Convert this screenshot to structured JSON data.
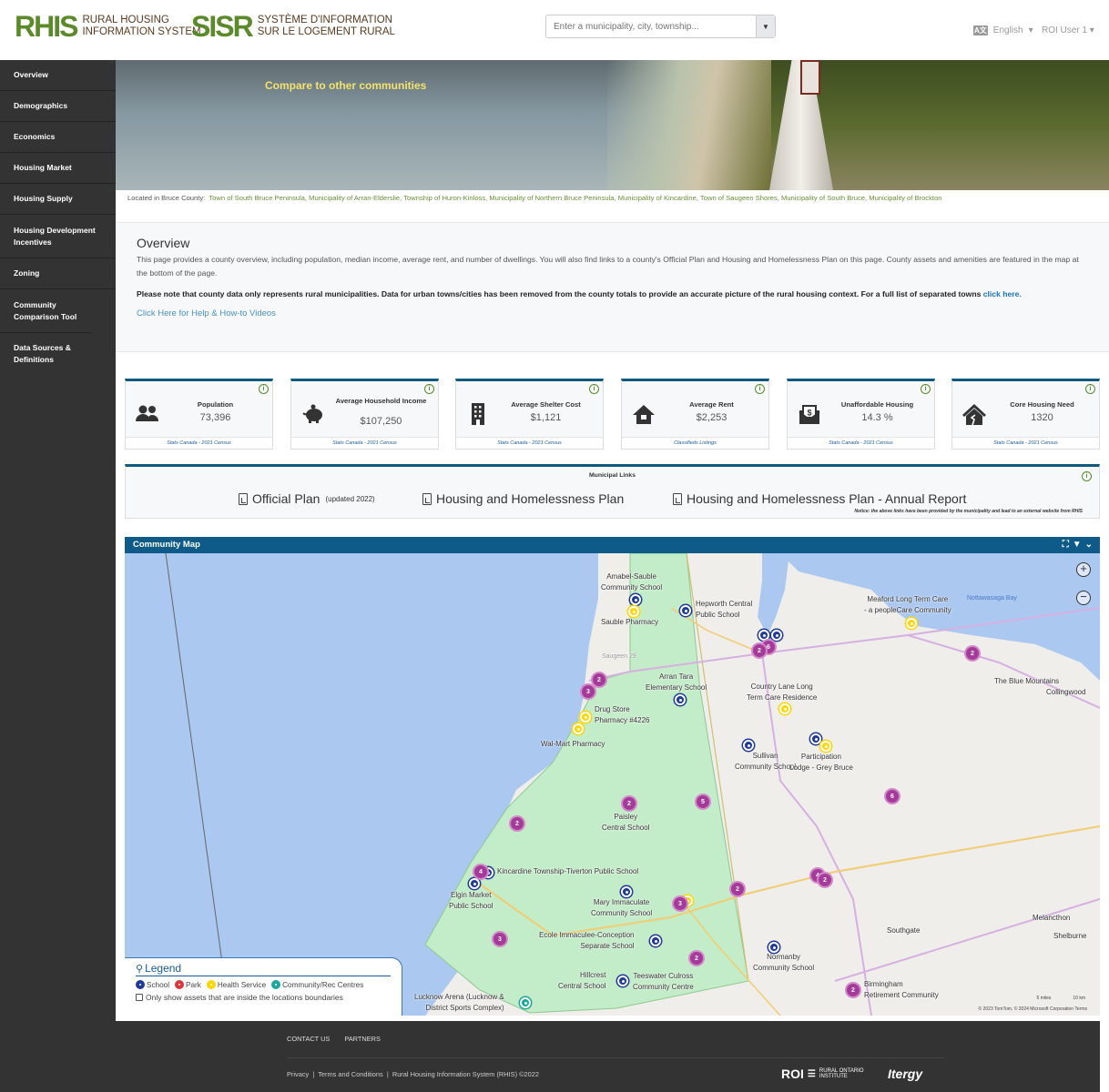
{
  "header": {
    "logo_en": {
      "acronym": "RHIS",
      "line1": "RURAL HOUSING",
      "line2": "INFORMATION SYSTEM"
    },
    "logo_fr": {
      "acronym": "SISR",
      "line1": "SYSTÈME D'INFORMATION",
      "line2": "SUR LE LOGEMENT RURAL"
    },
    "search": {
      "placeholder": "Enter a municipality, city, township...",
      "value": "",
      "dropdown_icon": "caret-down"
    },
    "language": {
      "icon": "translate-icon",
      "label": "English",
      "caret": "▾"
    },
    "user": {
      "label": "ROI User 1",
      "caret": "▾"
    }
  },
  "sidebar": {
    "items": [
      {
        "label": "Overview",
        "active": true
      },
      {
        "label": "Demographics"
      },
      {
        "label": "Economics"
      },
      {
        "label": "Housing Market"
      },
      {
        "label": "Housing Supply"
      },
      {
        "label": "Housing Development Incentives"
      },
      {
        "label": "Zoning"
      },
      {
        "label": "Community Comparison Tool"
      },
      {
        "label": "Data Sources & Definitions"
      }
    ]
  },
  "hero": {
    "compare_link": "Compare to other communities",
    "located_prefix": "Located in Bruce County:",
    "municipalities": "Town of South Bruce Peninsula, Municipality of Arran-Elderslie, Township of Huron-Kinloss, Municipality of Northern Bruce Peninsula, Municipality of Kincardine, Town of Saugeen Shores, Municipality of South Bruce, Municipality of Brockton"
  },
  "overview": {
    "title": "Overview",
    "description": "This page provides a county overview, including population, median income, average rent, and number of dwellings. You will also find links to a county's Official Plan and Housing and Homelessness Plan on this page. County assets and amenities are featured in the map at the bottom of the page.",
    "note": "Please note that county data only represents rural municipalities. Data for urban towns/cities has been removed from the county totals to provide an accurate picture of the rural housing context. For a full list of separated towns",
    "note_link": "click here.",
    "help_link": "Click Here for Help & How-to Videos"
  },
  "stats": [
    {
      "label": "Population",
      "value": "73,396",
      "source": "Stats Canada - 2021 Census",
      "icon": "users-icon"
    },
    {
      "label": "Average Household Income",
      "value": "$107,250",
      "source": "Stats Canada - 2021 Census",
      "icon": "piggy-bank-icon"
    },
    {
      "label": "Average Shelter Cost",
      "value": "$1,121",
      "source": "Stats Canada - 2021 Census",
      "icon": "building-icon"
    },
    {
      "label": "Average Rent",
      "value": "$2,253",
      "source": "Classifieds Listings",
      "icon": "house-icon"
    },
    {
      "label": "Unaffordable Housing",
      "value": "14.3 %",
      "source": "Stats Canada - 2021 Census",
      "icon": "money-envelope-icon"
    },
    {
      "label": "Core Housing Need",
      "value": "1320",
      "source": "Stats Canada - 2021 Census",
      "icon": "house-damage-icon"
    }
  ],
  "municipal_links": {
    "title": "Municipal Links",
    "links": [
      {
        "label": "Official Plan",
        "note": "(updated 2022)"
      },
      {
        "label": "Housing and Homelessness Plan",
        "note": ""
      },
      {
        "label": "Housing and Homelessness Plan - Annual Report",
        "note": ""
      }
    ],
    "notice": "Notice: the above links have been provided by the municipality and lead to an external website from RHIS"
  },
  "map": {
    "title": "Community Map",
    "controls": [
      "fullscreen-icon",
      "filter-icon",
      "chevron-down-icon"
    ],
    "zoom_in": "+",
    "zoom_out": "−",
    "labels": [
      {
        "text": "Amabel-Sauble\nCommunity School"
      },
      {
        "text": "Hepworth Central\nPublic School"
      },
      {
        "text": "Sauble Pharmacy"
      },
      {
        "text": "Saugeen 29"
      },
      {
        "text": "Arran Tara\nElementary School"
      },
      {
        "text": "Drug Store\nPharmacy #4226"
      },
      {
        "text": "Wal-Mart Pharmacy"
      },
      {
        "text": "Country Lane Long\nTerm Care Residence"
      },
      {
        "text": "Sullivan\nCommunity School"
      },
      {
        "text": "Participation\nLodge - Grey Bruce"
      },
      {
        "text": "Meaford Long Term Care\n- a peopleCare Community"
      },
      {
        "text": "Nottawasaga Bay"
      },
      {
        "text": "The Blue Mountains"
      },
      {
        "text": "Collingwood"
      },
      {
        "text": "Paisley\nCentral School"
      },
      {
        "text": "Kincardine Township-Tiverton Public School"
      },
      {
        "text": "Elgin Market\nPublic School"
      },
      {
        "text": "Mary Immaculate\nCommunity School"
      },
      {
        "text": "Ecole Immaculee-Conception\nSeparate School"
      },
      {
        "text": "Normanby\nCommunity School"
      },
      {
        "text": "Hillcrest\nCentral School"
      },
      {
        "text": "Teeswater Culross\nCommunity Centre"
      },
      {
        "text": "Lucknow Arena (Lucknow &\nDistrict Sports Complex)"
      },
      {
        "text": "Southgate"
      },
      {
        "text": "Melancthon"
      },
      {
        "text": "Shelburne"
      },
      {
        "text": "Birmingham\nRetirement Community"
      }
    ],
    "clusters": [
      "6",
      "2",
      "2",
      "3",
      "2",
      "5",
      "2",
      "4",
      "3",
      "2",
      "3",
      "2",
      "4",
      "2",
      "2",
      "2",
      "3"
    ],
    "scale": {
      "miles": "5 miles",
      "km": "10 km"
    },
    "attribution": "© 2023 TomTom, © 2024 Microsoft Corporation  Terms",
    "legend": {
      "title": "Legend",
      "items": [
        {
          "label": "School",
          "color": "#1e3a9a"
        },
        {
          "label": "Park",
          "color": "#e0353a"
        },
        {
          "label": "Health Service",
          "color": "#ffd700"
        },
        {
          "label": "Community/Rec Centres",
          "color": "#1aa7a0"
        }
      ],
      "checkbox_label": "Only show assets that are inside the locations boundaries",
      "checkbox_checked": false
    }
  },
  "footer": {
    "links_top": [
      "CONTACT US",
      "PARTNERS"
    ],
    "privacy": "Privacy",
    "terms": "Terms and Conditions",
    "copyright": "Rural Housing Information System (RHIS) ©2022",
    "roi_logo": "ROI",
    "roi_text": "RURAL ONTARIO INSTITUTE",
    "itergy_logo": "Itergy"
  },
  "colors": {
    "brand_green": "#5a8a2a",
    "brand_brown": "#5a3a1e",
    "header_blue": "#0e5a88",
    "sidebar": "#333333",
    "link_blue": "#1a73c9"
  }
}
